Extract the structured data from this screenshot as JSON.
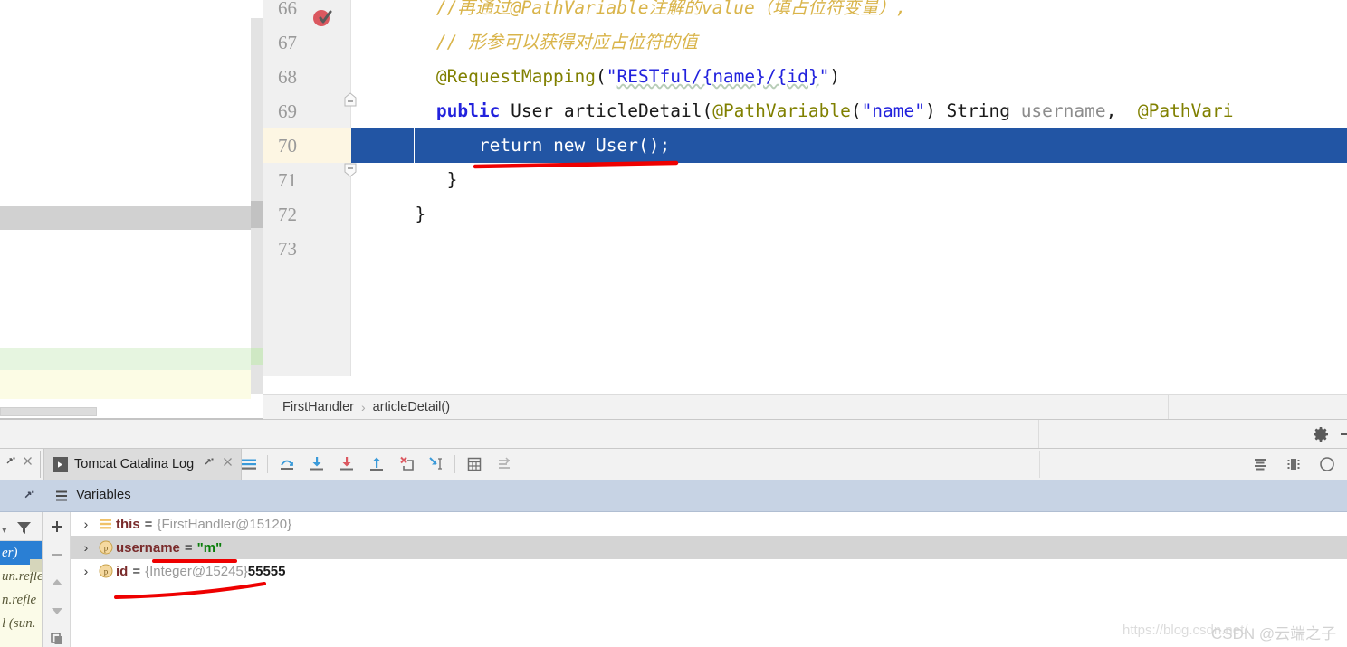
{
  "editor": {
    "lines": [
      {
        "no": "66",
        "indent": 8,
        "tokens": [
          {
            "t": "//再通过@PathVariable注解的value（填占位符变量）,",
            "c": "t-comment"
          }
        ]
      },
      {
        "no": "67",
        "indent": 8,
        "tokens": [
          {
            "t": "// 形参可以获得对应占位符的值",
            "c": "t-comment"
          }
        ]
      },
      {
        "no": "68",
        "indent": 8,
        "tokens": [
          {
            "t": "@RequestMapping",
            "c": "t-annot"
          },
          {
            "t": "(",
            "c": "t-plain"
          },
          {
            "t": "\"",
            "c": "t-string"
          },
          {
            "t": "RESTful/{name}/{id}",
            "c": "t-string squiggle"
          },
          {
            "t": "\"",
            "c": "t-string"
          },
          {
            "t": ")",
            "c": "t-plain"
          }
        ]
      },
      {
        "no": "69",
        "indent": 8,
        "tokens": [
          {
            "t": "public",
            "c": "t-keyword"
          },
          {
            "t": " User articleDetail",
            "c": "t-plain"
          },
          {
            "t": "(",
            "c": "t-plain"
          },
          {
            "t": "@PathVariable",
            "c": "t-annot"
          },
          {
            "t": "(",
            "c": "t-plain"
          },
          {
            "t": "\"name\"",
            "c": "t-string"
          },
          {
            "t": ") String ",
            "c": "t-plain"
          },
          {
            "t": "username",
            "c": "t-param"
          },
          {
            "t": ",  ",
            "c": "t-plain"
          },
          {
            "t": "@PathVari",
            "c": "t-annot"
          }
        ]
      },
      {
        "no": "70",
        "indent": 12,
        "highlight": true,
        "tokens": [
          {
            "t": "return new User();",
            "c": "code-text"
          }
        ]
      },
      {
        "no": "71",
        "indent": 9,
        "tokens": [
          {
            "t": "}",
            "c": "t-brace"
          }
        ]
      },
      {
        "no": "72",
        "indent": 6,
        "tokens": [
          {
            "t": "}",
            "c": "t-brace"
          }
        ]
      },
      {
        "no": "73",
        "indent": 6,
        "tokens": [
          {
            "t": "",
            "c": "t-plain"
          }
        ]
      }
    ],
    "breakpoint_line": "70",
    "gutter_icon": "breakpoint-verified-icon"
  },
  "breadcrumb": {
    "class_name": "FirstHandler",
    "separator": "›",
    "method_name": "articleDetail()"
  },
  "debug_toolbar": {
    "tab_label": "Tomcat Catalina Log",
    "buttons": [
      {
        "name": "show-execution-point",
        "glyph": "lines-icon"
      },
      {
        "name": "step-over",
        "glyph": "step-over-icon"
      },
      {
        "name": "step-into",
        "glyph": "step-into-icon"
      },
      {
        "name": "force-step-into",
        "glyph": "force-step-into-icon"
      },
      {
        "name": "step-out",
        "glyph": "step-out-icon"
      },
      {
        "name": "drop-frame",
        "glyph": "drop-frame-icon"
      },
      {
        "name": "run-to-cursor",
        "glyph": "run-to-cursor-icon"
      },
      {
        "name": "evaluate-expression",
        "glyph": "calculator-icon"
      },
      {
        "name": "settings-list",
        "glyph": "settings-list-icon"
      }
    ],
    "right_buttons": [
      {
        "name": "layout-settings",
        "glyph": "layout-icon"
      },
      {
        "name": "restore-layout",
        "glyph": "restore-layout-icon"
      },
      {
        "name": "help",
        "glyph": "help-icon"
      }
    ]
  },
  "toolwindow_settings": {
    "gear_label": "gear-icon",
    "minimize_label": "minimize-icon"
  },
  "variables_panel": {
    "title": "Variables",
    "rows": [
      {
        "expander": "›",
        "icon": "object-icon",
        "icon_type": "object",
        "name": "this",
        "eq": "=",
        "ref": "{FirstHandler@15120}",
        "value": "",
        "value_type": "",
        "selected": false
      },
      {
        "expander": "›",
        "icon": "p",
        "icon_type": "param",
        "name": "username",
        "eq": "=",
        "ref": "",
        "value": "\"m\"",
        "value_type": "string",
        "selected": true
      },
      {
        "expander": "›",
        "icon": "p",
        "icon_type": "param",
        "name": "id",
        "eq": "=",
        "ref": "{Integer@15245}",
        "value": "55555",
        "value_type": "number",
        "selected": false
      }
    ],
    "side_buttons": [
      {
        "name": "add-watch",
        "glyph": "+"
      },
      {
        "name": "remove-watch",
        "glyph": "−"
      },
      {
        "name": "move-up",
        "glyph": "▲"
      },
      {
        "name": "move-down",
        "glyph": "▼"
      },
      {
        "name": "copy-value",
        "glyph": "copy-icon"
      }
    ]
  },
  "frames_panel": {
    "rows": [
      {
        "text": "er)",
        "selected": true
      },
      {
        "text": "un.refle",
        "selected": false
      },
      {
        "text": "n.refle",
        "selected": false
      },
      {
        "text": "l (sun.",
        "selected": false
      }
    ],
    "filter_icon": "filter-icon"
  },
  "watermark": {
    "url": "https://blog.csdn.net/",
    "label": "CSDN @云端之子"
  },
  "colors": {
    "selection_blue": "#2255a4",
    "annotation_red": "#ee0000",
    "current_line_gutter": "#fdf6e3",
    "variables_header": "#c7d3e4",
    "string_green": "#0a7d0a"
  }
}
